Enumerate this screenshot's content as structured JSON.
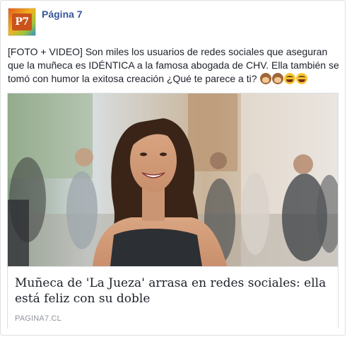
{
  "header": {
    "page_name": "Página 7",
    "avatar_text": "P7"
  },
  "post": {
    "text": "[FOTO + VIDEO] Son miles los usuarios de redes sociales que aseguran que la muñeca es IDÉNTICA a la famosa abogada de CHV. Ella también se tomó con humor la exitosa creación ¿Qué te parece a ti?",
    "emojis": [
      "see-no-evil-monkey-icon",
      "see-no-evil-monkey-icon",
      "laughing-face-icon",
      "laughing-face-icon"
    ]
  },
  "link_card": {
    "title": "Muñeca de 'La Jueza' arrasa en redes sociales: ella está feliz con su doble",
    "domain": "PAGINA7.CL"
  },
  "colors": {
    "link_blue": "#365899",
    "text": "#1d2129",
    "muted": "#90949c",
    "border": "#dddfe2"
  }
}
